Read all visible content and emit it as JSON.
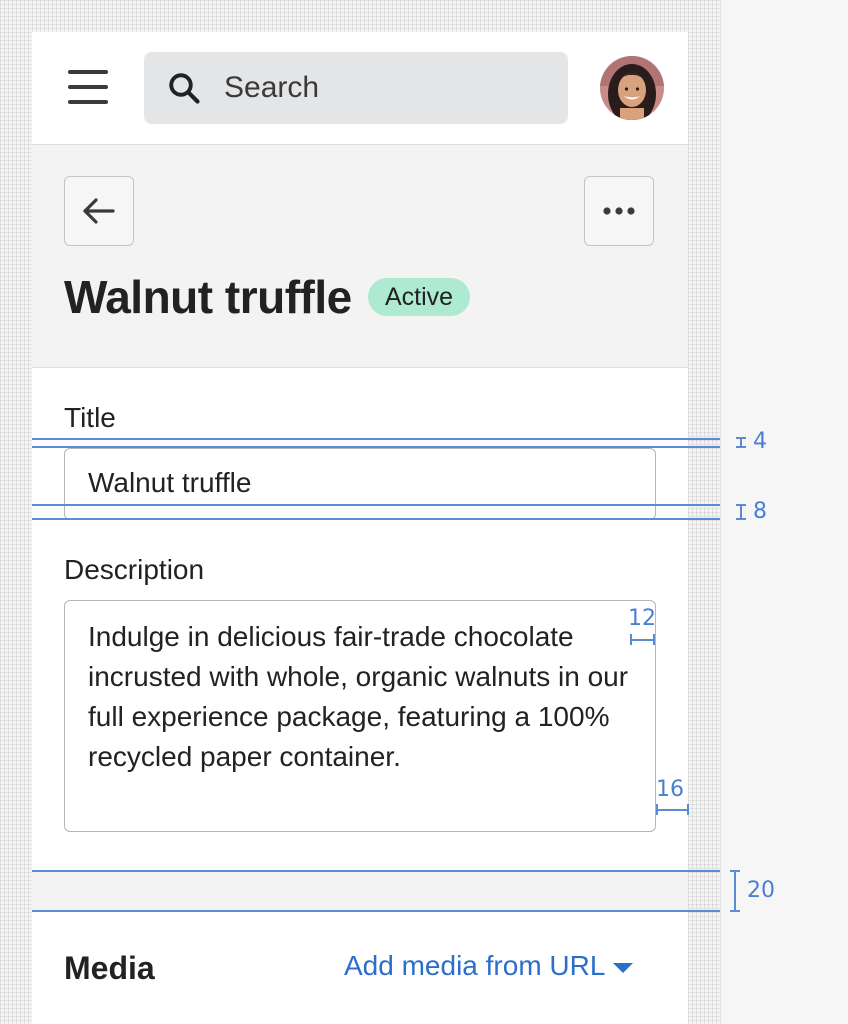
{
  "topbar": {
    "search_placeholder": "Search",
    "menu_icon": "hamburger-menu-icon",
    "search_icon": "search-icon"
  },
  "header": {
    "title": "Walnut truffle",
    "status": "Active",
    "status_color": "#aee9d1",
    "back_icon": "arrow-left-icon",
    "more_icon": "ellipsis-horizontal-icon"
  },
  "form": {
    "title_label": "Title",
    "title_value": "Walnut truffle",
    "description_label": "Description",
    "description_value": "Indulge in delicious fair-trade chocolate incrusted with whole, organic walnuts in our full experience package, featuring a 100% recycled paper container."
  },
  "media": {
    "heading": "Media",
    "add_link": "Add media from URL",
    "link_color": "#2c6ecb"
  },
  "annotations": {
    "label_gap": "4",
    "field_gap": "8",
    "inner_padding_top": "12",
    "inner_padding_side": "16",
    "section_gap": "20",
    "color": "#5b8ad6"
  }
}
